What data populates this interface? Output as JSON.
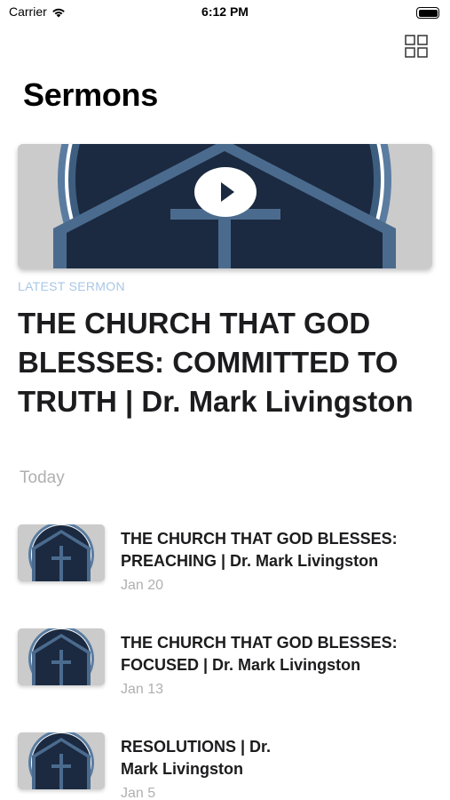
{
  "status_bar": {
    "carrier": "Carrier",
    "time": "6:12 PM"
  },
  "header": {
    "title": "Sermons"
  },
  "featured": {
    "label": "LATEST SERMON",
    "title": "THE CHURCH THAT GOD BLESSES: COMMITTED TO TRUTH | Dr. Mark Livingston",
    "date": "Today"
  },
  "sermons": [
    {
      "title": "THE CHURCH THAT GOD BLESSES: PREACHING | Dr. Mark Livingston",
      "date": "Jan 20"
    },
    {
      "title": "THE CHURCH THAT GOD BLESSES: FOCUSED | Dr. Mark Livingston",
      "date": "Jan 13"
    },
    {
      "title": "RESOLUTIONS | Dr. Mark Livingston",
      "date": "Jan 5"
    }
  ],
  "icons": {
    "wifi": "wifi-icon",
    "battery": "battery-icon",
    "grid": "grid-view-icon",
    "play": "play-icon"
  },
  "colors": {
    "accent_label": "#a9c7e6",
    "artwork_dark": "#1b2a40",
    "artwork_mid": "#4b6b8e",
    "artwork_ring": "#5a7ca0"
  }
}
